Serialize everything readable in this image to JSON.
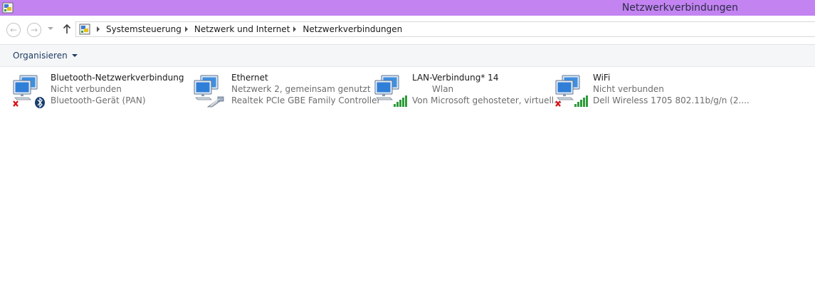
{
  "window": {
    "title": "Netzwerkverbindungen",
    "app_icon": "network-connections-icon",
    "titlebar_color": "#c383f1"
  },
  "nav": {
    "back_icon": "back-arrow-icon",
    "forward_icon": "forward-arrow-icon",
    "up_icon": "up-arrow-icon",
    "breadcrumb": [
      "Systemsteuerung",
      "Netzwerk und Internet",
      "Netzwerkverbindungen"
    ]
  },
  "toolbar": {
    "organize_label": "Organisieren"
  },
  "connections": [
    {
      "name": "Bluetooth-Netzwerkverbindung",
      "status": "Nicht verbunden",
      "device": "Bluetooth-Gerät (PAN)",
      "overlay_icons": [
        "disconnected-x-icon",
        "bluetooth-icon"
      ]
    },
    {
      "name": "Ethernet",
      "status": "Netzwerk  2, gemeinsam genutzt",
      "device": "Realtek PCIe GBE Family Controller",
      "overlay_icons": [
        "ethernet-cable-icon"
      ]
    },
    {
      "name": "LAN-Verbindung* 14",
      "status": "Wlan",
      "device": "Von Microsoft gehosteter, virtuell...",
      "overlay_icons": [
        "signal-bars-icon"
      ]
    },
    {
      "name": "WiFi",
      "status": "Nicht verbunden",
      "device": "Dell Wireless 1705 802.11b/g/n (2....",
      "overlay_icons": [
        "disconnected-x-icon",
        "signal-bars-icon"
      ]
    }
  ]
}
